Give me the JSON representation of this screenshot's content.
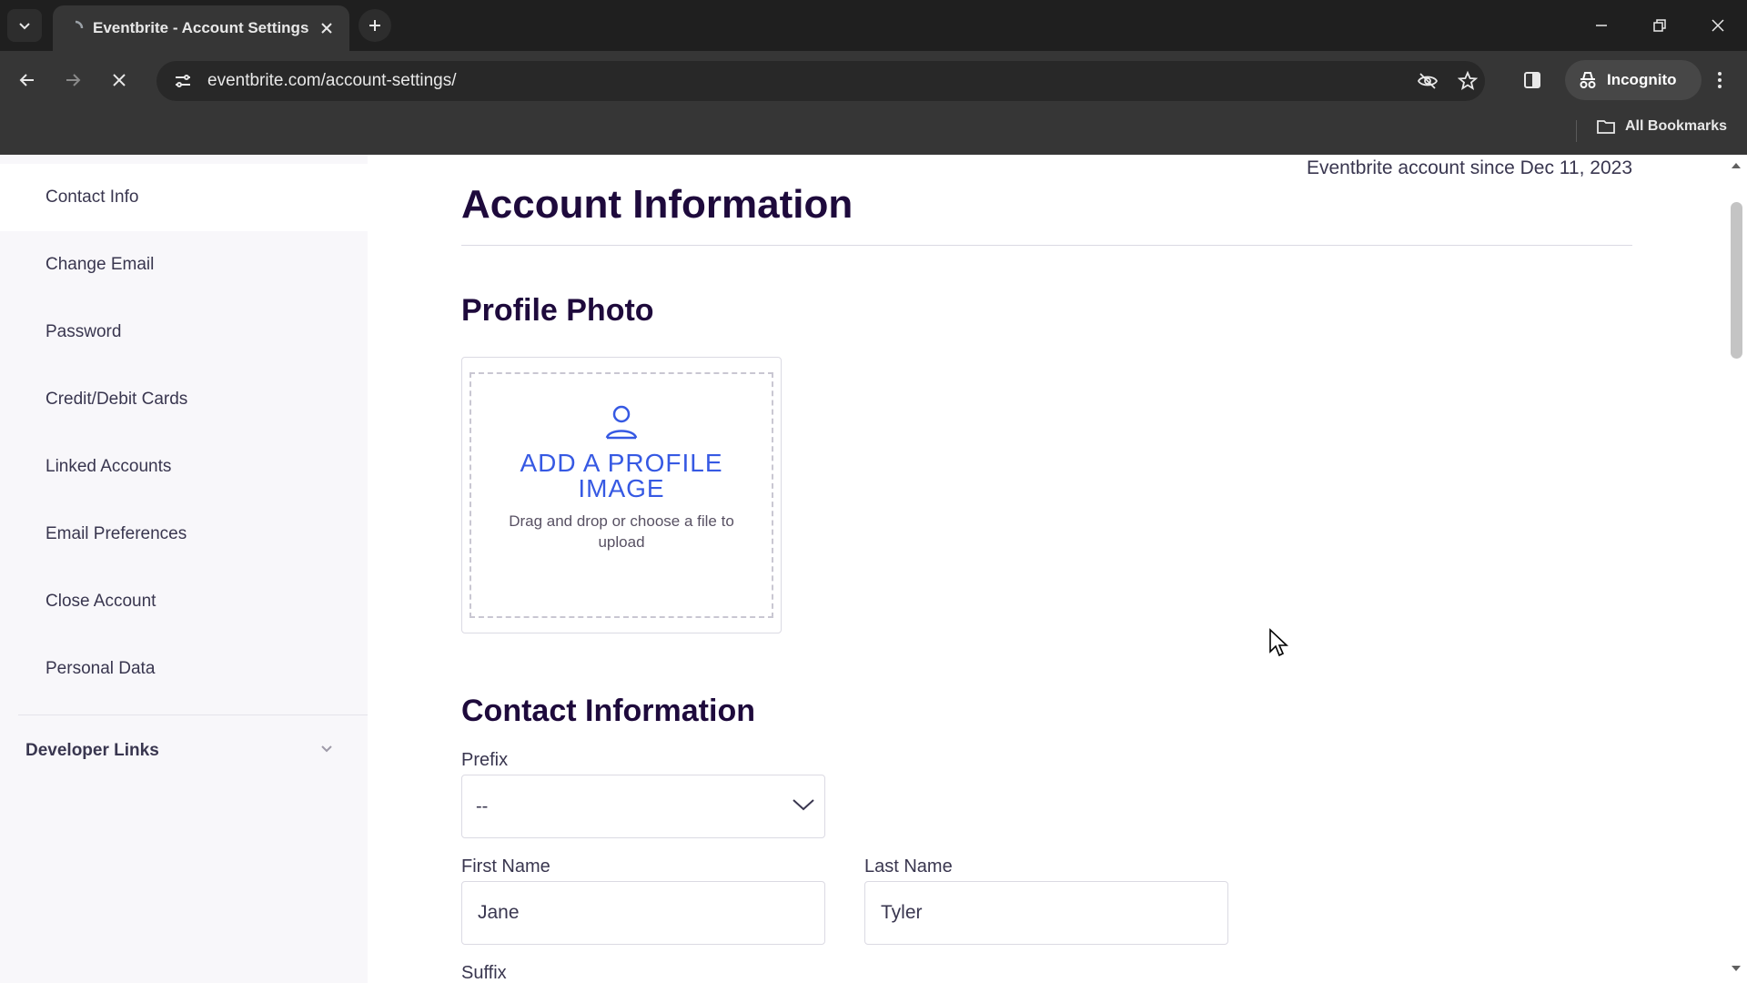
{
  "browser": {
    "tab_title": "Eventbrite - Account Settings",
    "url": "eventbrite.com/account-settings/",
    "incognito_label": "Incognito",
    "bookmarks_label": "All Bookmarks"
  },
  "sidebar": {
    "items": [
      {
        "label": "Contact Info",
        "active": true
      },
      {
        "label": "Change Email"
      },
      {
        "label": "Password"
      },
      {
        "label": "Credit/Debit Cards"
      },
      {
        "label": "Linked Accounts"
      },
      {
        "label": "Email Preferences"
      },
      {
        "label": "Close Account"
      },
      {
        "label": "Personal Data"
      }
    ],
    "developer_links": "Developer Links"
  },
  "main": {
    "account_since": "Eventbrite account since Dec 11, 2023",
    "title": "Account Information",
    "profile_photo": {
      "heading": "Profile Photo",
      "add_label": "ADD A PROFILE IMAGE",
      "hint": "Drag and drop or choose a file to upload"
    },
    "contact": {
      "heading": "Contact Information",
      "prefix_label": "Prefix",
      "prefix_value": "--",
      "first_name_label": "First Name",
      "first_name_value": "Jane",
      "last_name_label": "Last Name",
      "last_name_value": "Tyler",
      "suffix_label": "Suffix"
    }
  },
  "colors": {
    "accent": "#3659e3",
    "heading": "#1e0a3c",
    "sidebar_bg": "#f8f7fa"
  }
}
